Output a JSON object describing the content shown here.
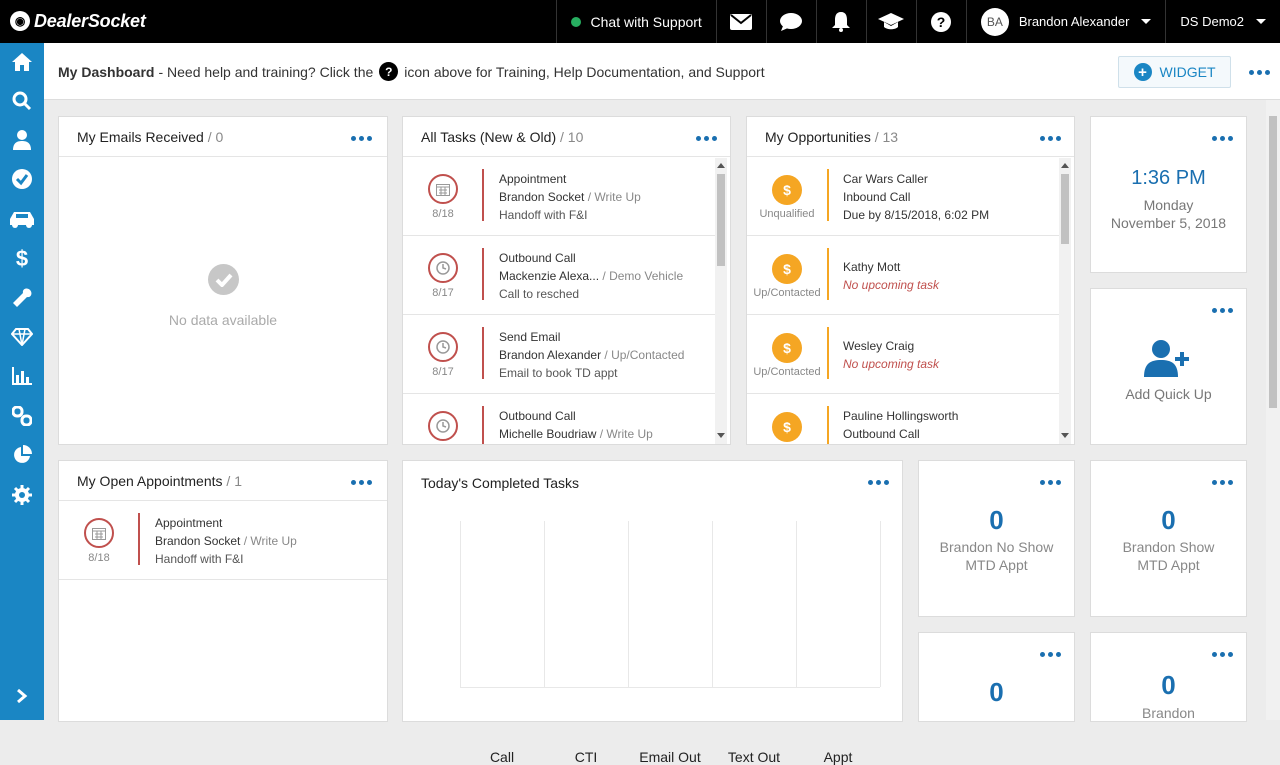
{
  "app": {
    "logo": "DealerSocket"
  },
  "topbar": {
    "chat_label": "Chat with Support",
    "icons": [
      "envelope-icon",
      "chat-bubble-icon",
      "bell-icon",
      "graduation-cap-icon",
      "help-icon"
    ],
    "user_initials": "BA",
    "user_name": "Brandon Alexander",
    "store": "DS Demo2"
  },
  "sidebar": {
    "items": [
      "home-icon",
      "search-icon",
      "contacts-icon",
      "tasks-check-icon",
      "vehicle-icon",
      "dollar-icon",
      "service-wrench-icon",
      "diamond-icon",
      "reports-icon",
      "links-icon",
      "pie-chart-icon",
      "settings-icon",
      "expand-icon"
    ]
  },
  "header": {
    "title": "My Dashboard",
    "help_text_pre": "- Need help and training? Click the",
    "help_text_post": "icon above for Training, Help Documentation, and Support",
    "widget_label": "WIDGET"
  },
  "emails": {
    "title": "My Emails Received",
    "count": "/ 0",
    "empty_text": "No data available"
  },
  "tasks": {
    "title": "All Tasks (New & Old)",
    "count": "/ 10",
    "rows": [
      {
        "date": "8/18",
        "icon": "calendar-icon",
        "type": "Appointment",
        "name": "Brandon Socket",
        "status": "/ Write Up",
        "note": "Handoff with F&I"
      },
      {
        "date": "8/17",
        "icon": "clock-icon",
        "type": "Outbound Call",
        "name": "Mackenzie Alexa...",
        "status": "/ Demo Vehicle",
        "note": "Call to resched"
      },
      {
        "date": "8/17",
        "icon": "clock-icon",
        "type": "Send Email",
        "name": "Brandon Alexander",
        "status": "/ Up/Contacted",
        "note": "Email to book TD appt"
      },
      {
        "date": "",
        "icon": "clock-icon",
        "type": "Outbound Call",
        "name": "Michelle Boudriaw",
        "status": "/ Write Up",
        "note": ""
      }
    ]
  },
  "opportunities": {
    "title": "My Opportunities",
    "count": "/ 13",
    "rows": [
      {
        "status": "Unqualified",
        "name": "Car Wars Caller",
        "line2": "Inbound Call",
        "line3": "Due by 8/15/2018, 6:02 PM"
      },
      {
        "status": "Up/Contacted",
        "name": "Kathy Mott",
        "line2": "No upcoming task",
        "line3": ""
      },
      {
        "status": "Up/Contacted",
        "name": "Wesley Craig",
        "line2": "No upcoming task",
        "line3": ""
      },
      {
        "status": "",
        "name": "Pauline Hollingsworth",
        "line2": "Outbound Call",
        "line3": ""
      }
    ]
  },
  "clock": {
    "time": "1:36 PM",
    "day": "Monday",
    "date": "November 5, 2018"
  },
  "quickup": {
    "label": "Add Quick Up"
  },
  "appointments": {
    "title": "My Open Appointments",
    "count": "/ 1",
    "rows": [
      {
        "date": "8/18",
        "type": "Appointment",
        "name": "Brandon Socket",
        "status": "/ Write Up",
        "note": "Handoff with F&I"
      }
    ]
  },
  "completed": {
    "title": "Today's Completed Tasks"
  },
  "chart_data": {
    "type": "bar",
    "title": "Today's Completed Tasks",
    "categories": [
      "Call",
      "CTI",
      "Email Out",
      "Text Out",
      "Appt"
    ],
    "values": [
      0,
      0,
      0,
      0,
      0
    ],
    "xlabel": "",
    "ylabel": ""
  },
  "stats": [
    {
      "value": "0",
      "line1": "Brandon No Show",
      "line2": "MTD Appt"
    },
    {
      "value": "0",
      "line1": "Brandon Show",
      "line2": "MTD Appt"
    },
    {
      "value": "0",
      "line1": "",
      "line2": ""
    },
    {
      "value": "0",
      "line1": "Brandon",
      "line2": ""
    }
  ]
}
